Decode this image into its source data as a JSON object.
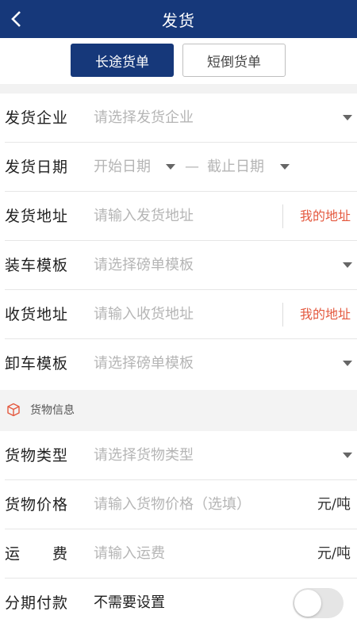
{
  "header": {
    "title": "发货",
    "back_icon": "chevron-left-icon"
  },
  "tabs": [
    {
      "label": "长途货单",
      "active": true
    },
    {
      "label": "短倒货单",
      "active": false
    }
  ],
  "form": {
    "company": {
      "label": "发货企业",
      "placeholder": "请选择发货企业"
    },
    "date": {
      "label": "发货日期",
      "start": "开始日期",
      "separator": "—",
      "end": "截止日期"
    },
    "ship_address": {
      "label": "发货地址",
      "placeholder": "请输入发货地址",
      "link": "我的地址"
    },
    "load_template": {
      "label": "装车模板",
      "placeholder": "请选择磅单模板"
    },
    "receive_address": {
      "label": "收货地址",
      "placeholder": "请输入收货地址",
      "link": "我的地址"
    },
    "unload_template": {
      "label": "卸车模板",
      "placeholder": "请选择磅单模板"
    }
  },
  "cargo_section": {
    "title": "货物信息",
    "icon": "package-icon"
  },
  "cargo": {
    "type": {
      "label": "货物类型",
      "placeholder": "请选择货物类型"
    },
    "price": {
      "label": "货物价格",
      "placeholder": "请输入货物价格（选填）",
      "unit": "元/吨"
    },
    "freight": {
      "label": "运　　费",
      "placeholder": "请输入运费",
      "unit": "元/吨"
    },
    "installment": {
      "label": "分期付款",
      "value": "不需要设置",
      "enabled": false
    }
  },
  "colors": {
    "primary": "#16387a",
    "link": "#e4593f",
    "placeholder": "#b5b5b5"
  }
}
